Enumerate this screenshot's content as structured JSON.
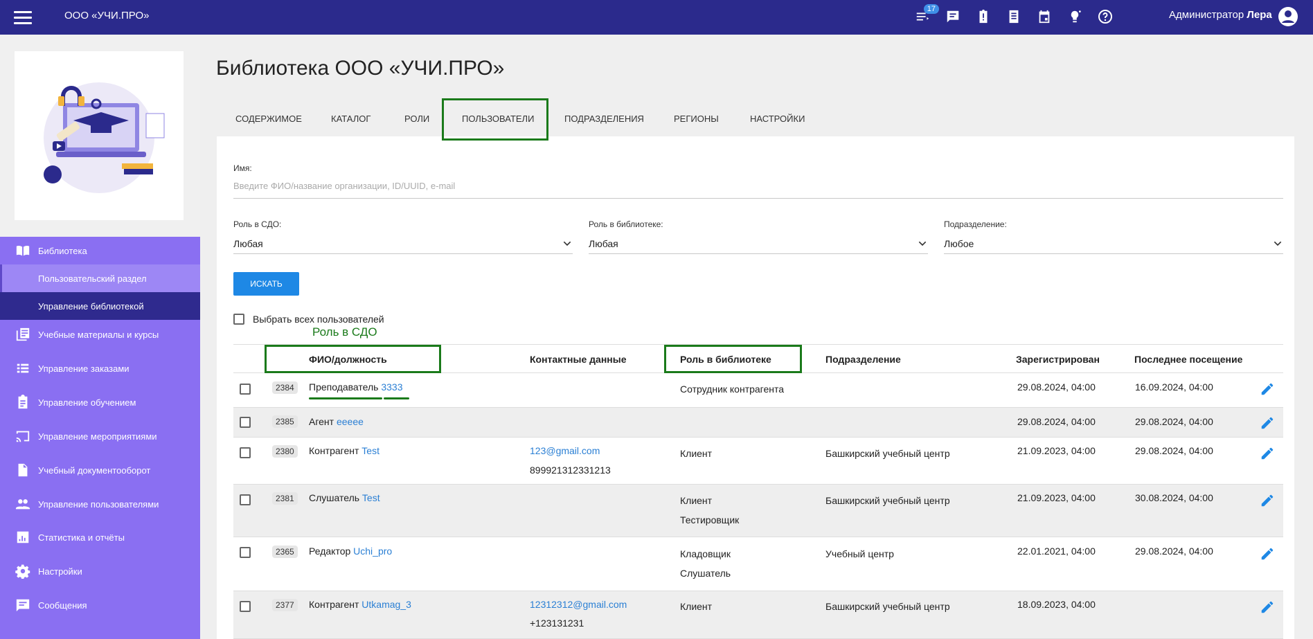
{
  "topbar": {
    "org_name": "ООО «УЧИ.ПРО»",
    "notifications_count": "17",
    "user_role": "Администратор",
    "user_name": "Лера",
    "icons": [
      "menu-icon",
      "list-icon",
      "chat-icon",
      "clipboard-alert-icon",
      "notes-icon",
      "calendar-icon",
      "lightbulb-icon",
      "help-icon",
      "account-icon"
    ]
  },
  "sidebar": {
    "library": "Библиотека",
    "user_section": "Пользовательский раздел",
    "library_management": "Управление библиотекой",
    "items": [
      {
        "label": "Учебные материалы и курсы",
        "icon": "library-books-icon"
      },
      {
        "label": "Управление заказами",
        "icon": "list-icon"
      },
      {
        "label": "Управление обучением",
        "icon": "assignment-icon"
      },
      {
        "label": "Управление мероприятиями",
        "icon": "cast-icon"
      },
      {
        "label": "Учебный документооборот",
        "icon": "document-icon"
      },
      {
        "label": "Управление пользователями",
        "icon": "people-icon"
      },
      {
        "label": "Статистика и отчёты",
        "icon": "chart-icon"
      },
      {
        "label": "Настройки",
        "icon": "gear-icon"
      },
      {
        "label": "Сообщения",
        "icon": "message-icon"
      }
    ]
  },
  "page": {
    "title": "Библиотека ООО «УЧИ.ПРО»",
    "tabs": [
      "СОДЕРЖИМОЕ",
      "КАТАЛОГ",
      "РОЛИ",
      "ПОЛЬЗОВАТЕЛИ",
      "ПОДРАЗДЕЛЕНИЯ",
      "РЕГИОНЫ",
      "НАСТРОЙКИ"
    ],
    "active_tab": "ПОЛЬЗОВАТЕЛИ"
  },
  "filters": {
    "name_label": "Имя:",
    "name_placeholder": "Введите ФИО/название организации, ID/UUID, e-mail",
    "sdo_role_label": "Роль в СДО:",
    "sdo_role_value": "Любая",
    "lib_role_label": "Роль в библиотеке:",
    "lib_role_value": "Любая",
    "division_label": "Подразделение:",
    "division_value": "Любое",
    "search_button": "ИСКАТЬ",
    "select_all": "Выбрать всех пользователей"
  },
  "annotation": {
    "sdo_role_note": "Роль в СДО"
  },
  "table": {
    "headers": {
      "name": "ФИО/должность",
      "contacts": "Контактные данные",
      "lib_role": "Роль в библиотеке",
      "division": "Подразделение",
      "registered": "Зарегистрирован",
      "last_visit": "Последнее посещение"
    },
    "rows": [
      {
        "id": "2384",
        "role": "Преподаватель",
        "name": "3333",
        "email": "",
        "phone": "",
        "lib_role_1": "Сотрудник контрагента",
        "lib_role_2": "",
        "division": "",
        "registered": "29.08.2024, 04:00",
        "last_visit": "16.09.2024, 04:00"
      },
      {
        "id": "2385",
        "role": "Агент",
        "name": "eeeee",
        "email": "",
        "phone": "",
        "lib_role_1": "",
        "lib_role_2": "",
        "division": "",
        "registered": "29.08.2024, 04:00",
        "last_visit": "29.08.2024, 04:00"
      },
      {
        "id": "2380",
        "role": "Контрагент",
        "name": "Test",
        "email": "123@gmail.com",
        "phone": "899921312331213",
        "lib_role_1": "Клиент",
        "lib_role_2": "",
        "division": "Башкирский учебный центр",
        "registered": "21.09.2023, 04:00",
        "last_visit": "29.08.2024, 04:00"
      },
      {
        "id": "2381",
        "role": "Слушатель",
        "name": "Test",
        "email": "",
        "phone": "",
        "lib_role_1": "Клиент",
        "lib_role_2": "Тестировщик",
        "division": "Башкирский учебный центр",
        "registered": "21.09.2023, 04:00",
        "last_visit": "30.08.2024, 04:00"
      },
      {
        "id": "2365",
        "role": "Редактор",
        "name": "Uchi_pro",
        "email": "",
        "phone": "",
        "lib_role_1": "Кладовщик",
        "lib_role_2": "Слушатель",
        "division": "Учебный центр",
        "registered": "22.01.2021, 04:00",
        "last_visit": "29.08.2024, 04:00"
      },
      {
        "id": "2377",
        "role": "Контрагент",
        "name": "Utkamag_3",
        "email": "12312312@gmail.com",
        "phone": "+123131231",
        "lib_role_1": "Клиент",
        "lib_role_2": "",
        "division": "Башкирский учебный центр",
        "registered": "18.09.2023, 04:00",
        "last_visit": ""
      }
    ]
  },
  "colors": {
    "topbar": "#2b2a8c",
    "sidebar_menu": "#8a6ff2",
    "active_sub": "#2f2a8e",
    "accent": "#1e88e5",
    "annotation": "#1a7a1a",
    "link": "#2a7fd4"
  }
}
